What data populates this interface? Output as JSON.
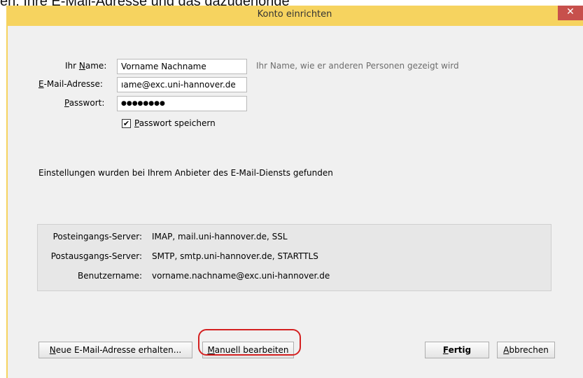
{
  "background": {
    "text": "en, Ihre E-Mail-Adresse und das dazugehörige"
  },
  "window": {
    "title": "Konto einrichten",
    "close_glyph": "✕"
  },
  "form": {
    "name_label_pre": "Ihr ",
    "name_label_u": "N",
    "name_label_post": "ame:",
    "name_value": "Vorname Nachname",
    "name_hint": "Ihr Name, wie er anderen Personen gezeigt wird",
    "email_label_u": "E",
    "email_label_post": "-Mail-Adresse:",
    "email_value": "ıame@exc.uni-hannover.de",
    "password_label_u": "P",
    "password_label_post": "asswort:",
    "password_value": "●●●●●●●●",
    "save_password_u": "P",
    "save_password_post": "asswort speichern",
    "save_password_checked": "✔"
  },
  "status_message": "Einstellungen wurden bei Ihrem Anbieter des E-Mail-Diensts gefunden",
  "server_info": {
    "incoming_label": "Posteingangs-Server:",
    "incoming_value": "IMAP, mail.uni-hannover.de, SSL",
    "outgoing_label": "Postausgangs-Server:",
    "outgoing_value": "SMTP, smtp.uni-hannover.de, STARTTLS",
    "username_label": "Benutzername:",
    "username_value": "vorname.nachname@exc.uni-hannover.de"
  },
  "buttons": {
    "new_address_u": "N",
    "new_address_post": "eue E-Mail-Adresse erhalten...",
    "manual_u": "M",
    "manual_post": "anuell bearbeiten",
    "done_u": "F",
    "done_post": "ertig",
    "cancel_u": "A",
    "cancel_post": "bbrechen"
  },
  "colors": {
    "titlebar": "#f6d35f",
    "close": "#c7504c",
    "highlight": "#d42020"
  }
}
